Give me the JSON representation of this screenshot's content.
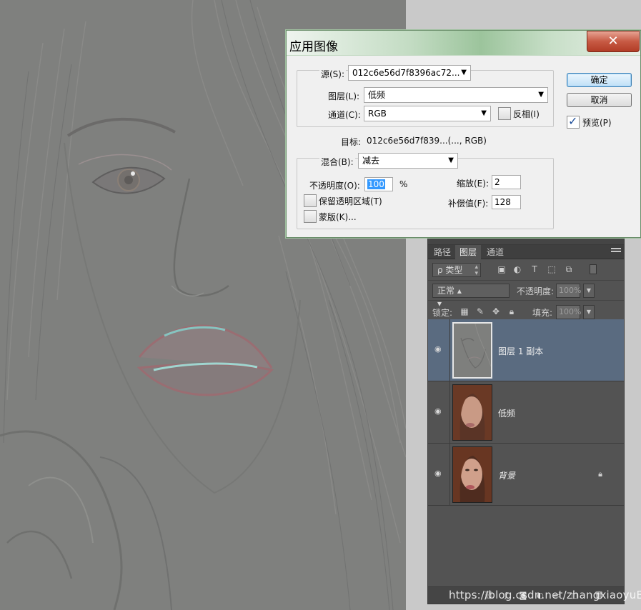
{
  "dialog": {
    "title": "应用图像",
    "close_glyph": "✕",
    "source_label": "源(S):",
    "source_value": "012c6e56d7f8396ac72...",
    "layer_label": "图层(L):",
    "layer_value": "低频",
    "channel_label": "通道(C):",
    "channel_value": "RGB",
    "invert_label": "反相(I)",
    "invert_checked": false,
    "target_label": "目标:",
    "target_value": "012c6e56d7f839...(..., RGB)",
    "blending_label": "混合(B):",
    "blending_value": "减去",
    "opacity_label": "不透明度(O):",
    "opacity_value": "100",
    "opacity_unit": "%",
    "scale_label": "缩放(E):",
    "scale_value": "2",
    "offset_label": "补偿值(F):",
    "offset_value": "128",
    "preserve_transparency_label": "保留透明区域(T)",
    "preserve_transparency_checked": false,
    "mask_label": "蒙版(K)...",
    "mask_checked": false,
    "ok_label": "确定",
    "cancel_label": "取消",
    "preview_label": "预览(P)",
    "preview_checked": true
  },
  "layers_panel": {
    "tabs": [
      {
        "label": "路径",
        "active": false
      },
      {
        "label": "图层",
        "active": true
      },
      {
        "label": "通道",
        "active": false
      }
    ],
    "filter_kind": "ρ 类型",
    "blend_mode": "正常",
    "opacity_label": "不透明度:",
    "opacity_value": "100%",
    "lock_label": "锁定:",
    "fill_label": "填充:",
    "fill_value": "100%",
    "layers": [
      {
        "name": "图层 1 副本",
        "selected": true,
        "visible": true,
        "locked": false,
        "italic": false
      },
      {
        "name": "低频",
        "selected": false,
        "visible": true,
        "locked": false,
        "italic": false
      },
      {
        "name": "背景",
        "selected": false,
        "visible": true,
        "locked": true,
        "italic": true
      }
    ]
  },
  "watermark": "https://blog.csdn.net/zhangxiaoyuBK",
  "colors": {
    "canvas_gray": "#7f807e",
    "panel_bg": "#535353",
    "selected_layer": "#5a6b80",
    "dialog_bg": "#f0f0f0",
    "close_red": "#c75a44",
    "selection_blue": "#3399ff"
  }
}
